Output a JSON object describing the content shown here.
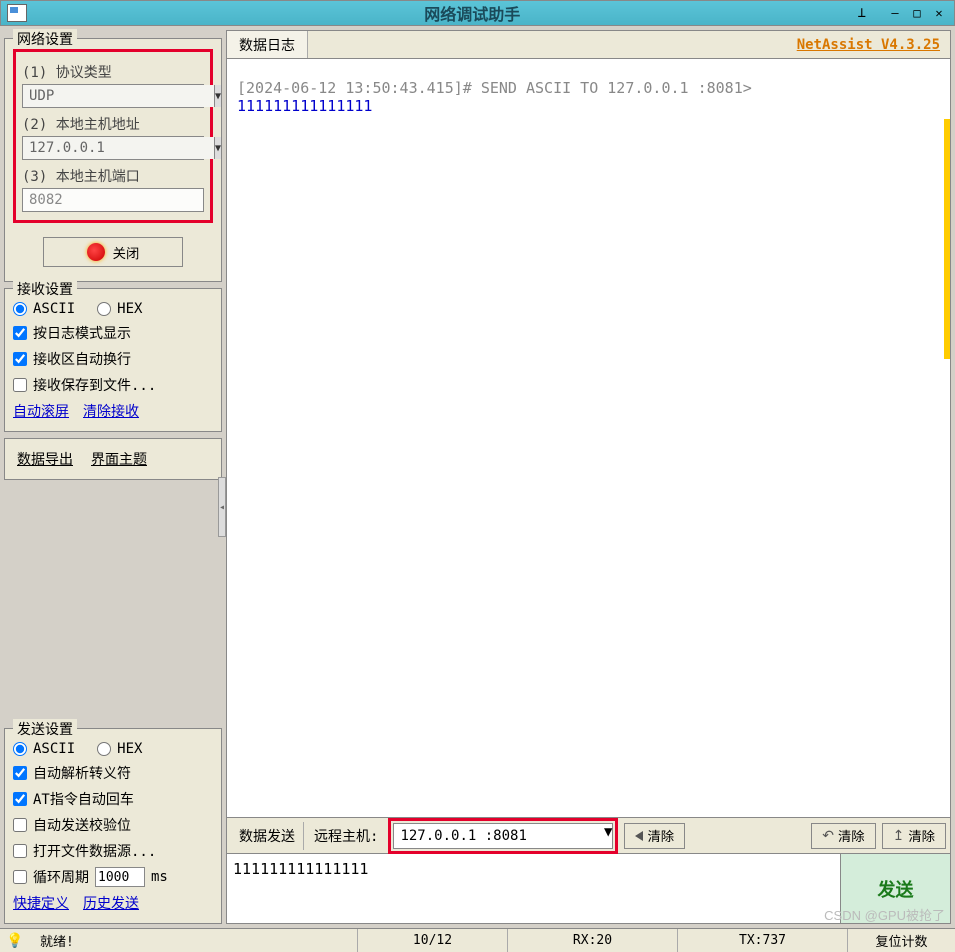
{
  "title": "网络调试助手",
  "version": "NetAssist V4.3.25",
  "network_settings": {
    "legend": "网络设置",
    "protocol_label": "(1) 协议类型",
    "protocol_value": "UDP",
    "host_label": "(2) 本地主机地址",
    "host_value": "127.0.0.1",
    "port_label": "(3) 本地主机端口",
    "port_value": "8082",
    "close_label": "关闭"
  },
  "recv_settings": {
    "legend": "接收设置",
    "ascii": "ASCII",
    "hex": "HEX",
    "log_mode": "按日志模式显示",
    "auto_wrap": "接收区自动换行",
    "save_file": "接收保存到文件...",
    "auto_scroll": "自动滚屏",
    "clear_recv": "清除接收"
  },
  "util": {
    "export": "数据导出",
    "theme": "界面主题"
  },
  "send_settings": {
    "legend": "发送设置",
    "ascii": "ASCII",
    "hex": "HEX",
    "auto_escape": "自动解析转义符",
    "at_enter": "AT指令自动回车",
    "auto_check": "自动发送校验位",
    "open_file": "打开文件数据源...",
    "cycle": "循环周期",
    "cycle_val": "1000",
    "cycle_unit": "ms",
    "quick_def": "快捷定义",
    "history": "历史发送"
  },
  "log": {
    "tab": "数据日志",
    "line1": "[2024-06-12 13:50:43.415]# SEND ASCII TO 127.0.0.1 :8081>",
    "line2": "111111111111111"
  },
  "send_bar": {
    "tab": "数据发送",
    "remote_label": "远程主机:",
    "remote_value": "127.0.0.1 :8081",
    "clear": "清除"
  },
  "send_area": {
    "text": "111111111111111",
    "send_btn": "发送"
  },
  "status": {
    "ready": "就绪!",
    "count": "10/12",
    "rx": "RX:20",
    "tx": "TX:737",
    "reset": "复位计数"
  },
  "watermark": "CSDN @GPU被抢了"
}
